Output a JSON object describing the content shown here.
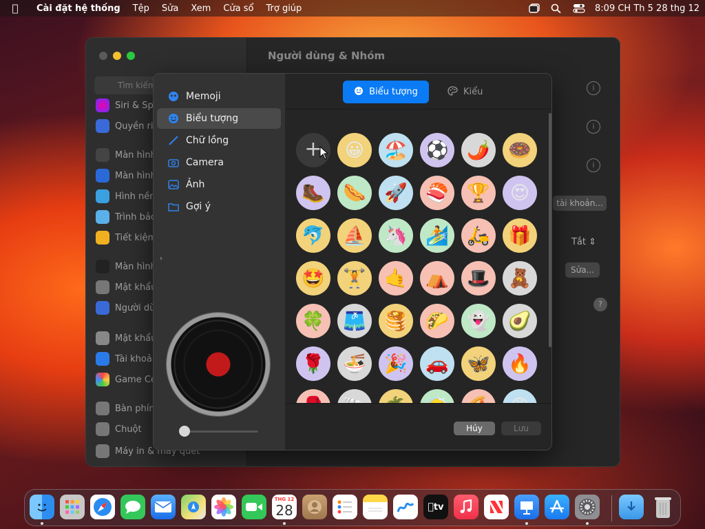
{
  "menubar": {
    "app": "Cài đặt hệ thống",
    "items": [
      "Tệp",
      "Sửa",
      "Xem",
      "Cửa sổ",
      "Trợ giúp"
    ],
    "clock": "8:09 CH Th 5 28 thg 12"
  },
  "window": {
    "title": "Người dùng & Nhóm",
    "search_placeholder": "Tìm kiếm",
    "sidebar": [
      "Siri & Spo",
      "Quyền riê",
      "Màn hình",
      "Màn hình",
      "Hình nền",
      "Trình bảo",
      "Tiết kiệm",
      "Màn hình",
      "Mật khẩu",
      "Người dù",
      "Mật khẩu",
      "Tài khoản",
      "Game Ce",
      "Bàn phím",
      "Chuột",
      "Máy in & máy quét"
    ],
    "accounts_button": "tài khoản...",
    "off_select": "Tắt",
    "edit_button": "Sửa..."
  },
  "dialog": {
    "sidebar": [
      "Memoji",
      "Biểu tượng",
      "Chữ lồng",
      "Camera",
      "Ảnh",
      "Gợi ý"
    ],
    "selected_index": 1,
    "tabs": [
      "Biểu tượng",
      "Kiểu"
    ],
    "cancel": "Hủy",
    "save": "Lưu",
    "emojis": [
      "😀",
      "🏖️",
      "⚽",
      "🌶️",
      "🍩",
      "🥾",
      "🌭",
      "🚀",
      "🍣",
      "🏆",
      "😍",
      "🐬",
      "⛵",
      "🦄",
      "🏄",
      "🛵",
      "🎁",
      "🤩",
      "🏋️",
      "🤙",
      "⛺",
      "🎩",
      "🧸",
      "🍀",
      "🩳",
      "🥞",
      "🌮",
      "👻",
      "🥑",
      "🌹",
      "🍜",
      "🎉",
      "🚗",
      "🦋",
      "🔥",
      "🥊",
      "🐚",
      "🌴",
      "😶‍🌫️",
      "🍕",
      "😡"
    ],
    "emoji_bg": [
      "#f2d27a",
      "#bfe0f0",
      "#cfc4ef",
      "#d8d8d8",
      "#f2d27a",
      "#cfc4ef",
      "#bfe8c6",
      "#bfe0f0",
      "#f6c0b4",
      "#f6c0b4",
      "#cfc4ef",
      "#f2d27a",
      "#f2d27a",
      "#bfe8c6",
      "#bfe8c6",
      "#f6c0b4",
      "#f2d27a",
      "#f2d27a",
      "#f2d27a",
      "#f6c0b4",
      "#f6c0b4",
      "#f6c0b4",
      "#d8d8d8",
      "#f6c0b4",
      "#d8d8d8",
      "#f2d27a",
      "#f6c0b4",
      "#bfe8c6",
      "#d8d8d8",
      "#cfc4ef",
      "#d8d8d8",
      "#cfc4ef",
      "#bfe0f0",
      "#f2d27a",
      "#cfc4ef",
      "#f6c0b4",
      "#d8d8d8",
      "#f2d27a",
      "#bfe8c6",
      "#f6c0b4",
      "#bfe0f0"
    ]
  },
  "dock": {
    "apps": [
      "Finder",
      "Launchpad",
      "Safari",
      "Tin nhắn",
      "Mail",
      "Bản đồ",
      "Ảnh",
      "FaceTime",
      "Lịch",
      "Danh bạ",
      "Lời nhắc",
      "Ghi chú",
      "Freeform",
      "TV",
      "Nhạc",
      "News",
      "Keynote",
      "App Store",
      "Cài đặt hệ thống",
      "Tải về",
      "Thùng rác"
    ],
    "calendar_month": "THG 12",
    "calendar_day": "28",
    "tv_label": "tv"
  },
  "colors": {
    "accent": "#0a7bf5"
  }
}
